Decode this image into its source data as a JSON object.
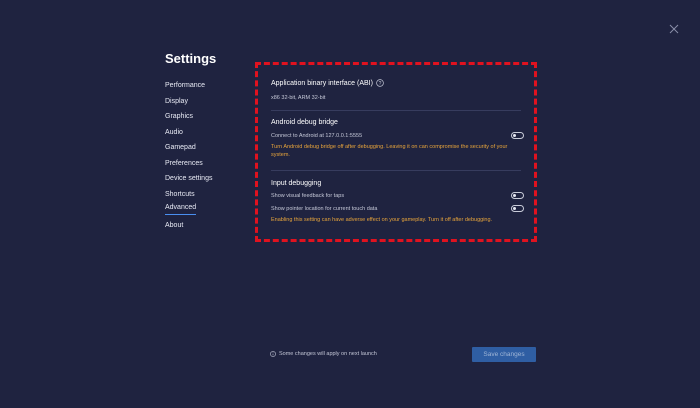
{
  "header": {
    "title": "Settings",
    "close_icon": "close-icon"
  },
  "sidebar": {
    "items": [
      {
        "label": "Performance",
        "active": false
      },
      {
        "label": "Display",
        "active": false
      },
      {
        "label": "Graphics",
        "active": false
      },
      {
        "label": "Audio",
        "active": false
      },
      {
        "label": "Gamepad",
        "active": false
      },
      {
        "label": "Preferences",
        "active": false
      },
      {
        "label": "Device settings",
        "active": false
      },
      {
        "label": "Shortcuts",
        "active": false
      },
      {
        "label": "Advanced",
        "active": true
      },
      {
        "label": "About",
        "active": false
      }
    ],
    "active_underline_color": "#4a8ff0"
  },
  "main": {
    "abi": {
      "title": "Application binary interface (ABI)",
      "help_icon": "question-circle-icon",
      "value": "x86 32-bit, ARM 32-bit"
    },
    "adb": {
      "title": "Android debug bridge",
      "toggle_label": "Connect to Android at 127.0.0.1:5555",
      "toggle_on": false,
      "warning": "Turn Android debug bridge off after debugging. Leaving it on can compromise the security of your system."
    },
    "input_debugging": {
      "title": "Input debugging",
      "visual_feedback_label": "Show visual feedback for taps",
      "visual_feedback_on": false,
      "pointer_location_label": "Show pointer location for current touch data",
      "pointer_location_on": false,
      "warning": "Enabling this setting can have adverse effect on your gameplay. Turn it off after  debugging."
    },
    "highlight_color": "#e0121f",
    "warning_color": "#e8a53b"
  },
  "footer": {
    "info_icon": "info-circle-icon",
    "note": "Some changes will apply on next launch",
    "save_label": "Save changes",
    "save_color": "#2f5ea3"
  }
}
